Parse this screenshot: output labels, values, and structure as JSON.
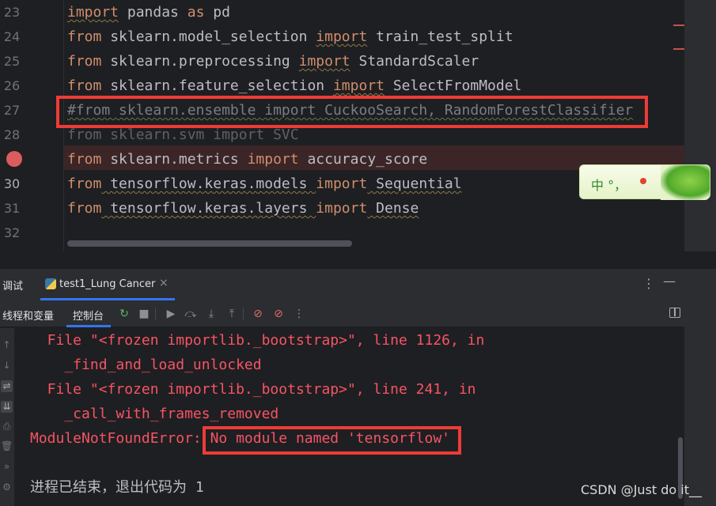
{
  "editor": {
    "lines": [
      {
        "num": "23",
        "tokens": [
          [
            "kw",
            "import"
          ],
          [
            "id",
            " pandas "
          ],
          [
            "kw",
            "as"
          ],
          [
            "id",
            " pd"
          ]
        ]
      },
      {
        "num": "24",
        "tokens": [
          [
            "kw",
            "from"
          ],
          [
            "id",
            " sklearn.model_selection "
          ],
          [
            "kw",
            "import"
          ],
          [
            "id",
            " train_test_split"
          ]
        ]
      },
      {
        "num": "25",
        "tokens": [
          [
            "kw",
            "from"
          ],
          [
            "id",
            " sklearn.preprocessing "
          ],
          [
            "kw",
            "import"
          ],
          [
            "id",
            " StandardScaler"
          ]
        ]
      },
      {
        "num": "26",
        "tokens": [
          [
            "kw",
            "from"
          ],
          [
            "id",
            " sklearn.feature_selection "
          ],
          [
            "kw",
            "import"
          ],
          [
            "id",
            " SelectFromModel"
          ]
        ]
      },
      {
        "num": "27",
        "tokens": [
          [
            "cmt",
            "#from sklearn.ensemble import CuckooSearch, RandomForestClassifier"
          ]
        ]
      },
      {
        "num": "28",
        "tokens": [
          [
            "dim",
            "from sklearn.svm import SVC"
          ]
        ]
      },
      {
        "num": "",
        "tokens": [
          [
            "kw",
            "from"
          ],
          [
            "id",
            " sklearn.metrics "
          ],
          [
            "kw",
            "import"
          ],
          [
            "id",
            " accuracy_score"
          ]
        ]
      },
      {
        "num": "30",
        "tokens": [
          [
            "kw",
            "from"
          ],
          [
            "id",
            " tensorflow.keras.models "
          ],
          [
            "kw",
            "import"
          ],
          [
            "id",
            " Sequential"
          ]
        ]
      },
      {
        "num": "31",
        "tokens": [
          [
            "kw",
            "from"
          ],
          [
            "id",
            " tensorflow.keras.layers "
          ],
          [
            "kw",
            "import"
          ],
          [
            "id",
            " Dense"
          ]
        ]
      },
      {
        "num": "32",
        "tokens": []
      }
    ],
    "current_line": "30",
    "breakpoint_color": "#db5c5c"
  },
  "ime": {
    "text": "中 °，"
  },
  "toolwindow": {
    "title": "调试",
    "tab_label": "test1_Lung Cancer",
    "close_glyph": "×",
    "more_glyph": "⋮",
    "minimize_glyph": "—",
    "subtabs": [
      "线程和变量",
      "控制台"
    ],
    "toolbar_icons": [
      {
        "name": "rerun-icon",
        "glyph": "↻"
      },
      {
        "name": "stop-icon",
        "glyph": "■"
      },
      {
        "name": "resume-icon",
        "glyph": "▶"
      },
      {
        "name": "step-over-icon",
        "glyph": "⤼"
      },
      {
        "name": "step-into-icon",
        "glyph": "⤓"
      },
      {
        "name": "step-out-icon",
        "glyph": "⤒"
      },
      {
        "name": "view-breakpoints-icon",
        "glyph": "⊘"
      },
      {
        "name": "mute-breakpoints-icon",
        "glyph": "⊘"
      },
      {
        "name": "more-icon",
        "glyph": "⋮"
      }
    ]
  },
  "console": {
    "lines": [
      "  File \"<frozen importlib._bootstrap>\", line 1126, in",
      "    _find_and_load_unlocked",
      "  File \"<frozen importlib._bootstrap>\", line 241, in",
      "    _call_with_frames_removed",
      "ModuleNotFoundError: No module named 'tensorflow'",
      "",
      "进程已结束，退出代码为 1"
    ],
    "error_color": "#f75464"
  },
  "watermark": "CSDN @Just do it__"
}
